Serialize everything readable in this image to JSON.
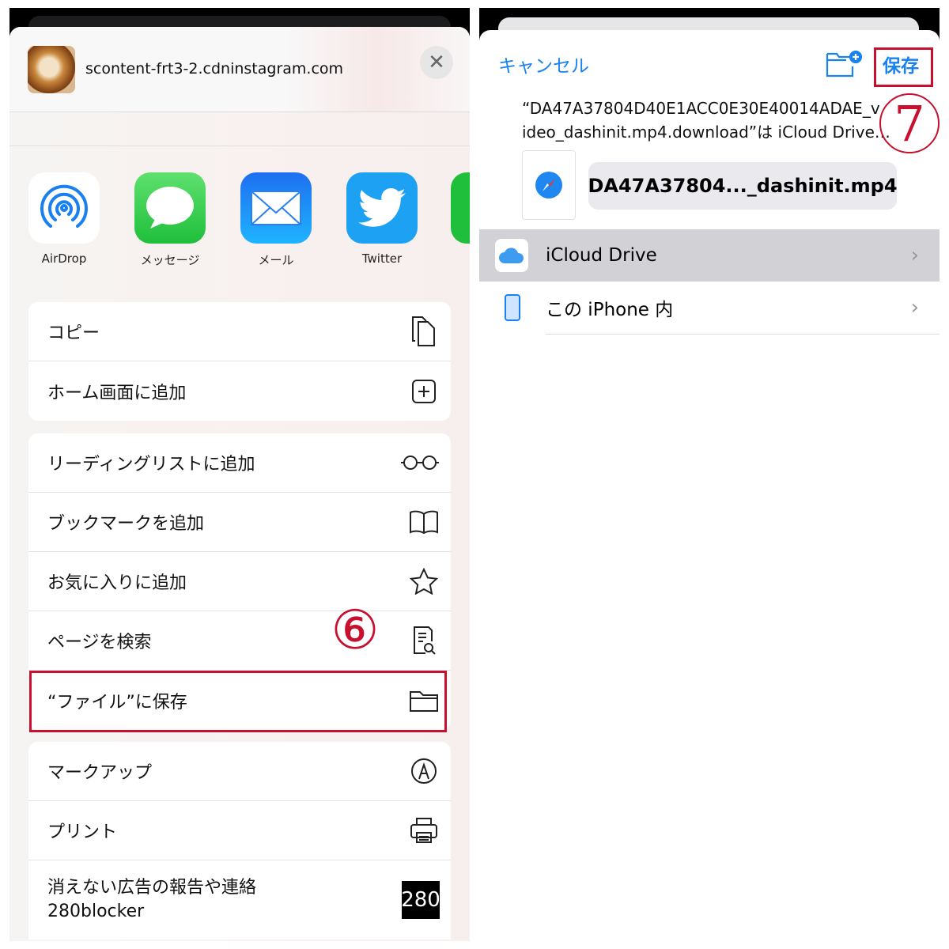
{
  "share_sheet": {
    "domain": "scontent-frt3-2.cdninstagram.com",
    "close_icon": "close-icon",
    "apps": [
      {
        "label": "AirDrop",
        "icon": "airdrop-icon",
        "color": "#1a7ff0"
      },
      {
        "label": "メッセージ",
        "icon": "messages-icon",
        "color": "#34c759"
      },
      {
        "label": "メール",
        "icon": "mail-icon",
        "color": "#1a8cff"
      },
      {
        "label": "Twitter",
        "icon": "twitter-icon",
        "color": "#1da1f2"
      }
    ],
    "group1": [
      {
        "label": "コピー",
        "icon": "copy-icon"
      },
      {
        "label": "ホーム画面に追加",
        "icon": "add-square-icon"
      }
    ],
    "group2": [
      {
        "label": "リーディングリストに追加",
        "icon": "glasses-icon"
      },
      {
        "label": "ブックマークを追加",
        "icon": "book-icon"
      },
      {
        "label": "お気に入りに追加",
        "icon": "star-icon"
      },
      {
        "label": "ページを検索",
        "icon": "find-in-page-icon"
      },
      {
        "label": "“ファイル”に保存",
        "icon": "folder-icon"
      }
    ],
    "group3": [
      {
        "label": "マークアップ",
        "icon": "markup-icon"
      },
      {
        "label": "プリント",
        "icon": "printer-icon"
      },
      {
        "label": "消えない広告の報告や連絡",
        "label2": "280blocker",
        "icon": "280blocker-icon",
        "badge": "280"
      }
    ],
    "step_label": "⑥"
  },
  "save_dialog": {
    "cancel": "キャンセル",
    "new_folder_icon": "new-folder-icon",
    "save": "保存",
    "message_line1": "“DA47A37804D40E1ACC0E30E40014ADAE_v",
    "message_line2": "ideo_dashinit.mp4.download”は iCloud Drive…",
    "filename": "DA47A37804..._dashinit.mp4",
    "locations": [
      {
        "label": "iCloud Drive",
        "icon": "icloud-icon",
        "selected": true
      },
      {
        "label": "この iPhone 内",
        "icon": "iphone-icon",
        "selected": false
      }
    ],
    "step_label": "7",
    "accent": "#1a82f0",
    "highlight": "#c8102e"
  }
}
